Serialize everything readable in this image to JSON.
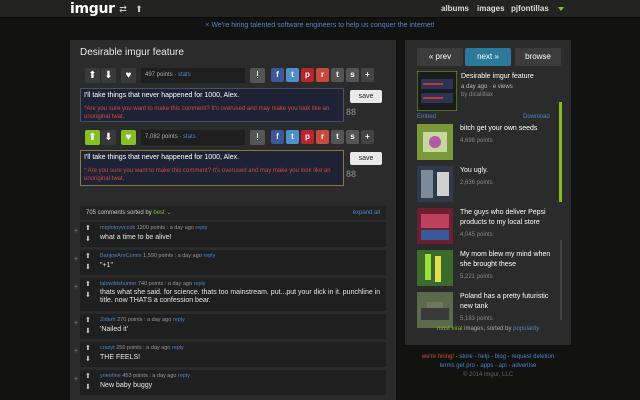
{
  "topbar": {
    "logo": "imgur",
    "nav": [
      "albums",
      "images"
    ],
    "user": "pjfontillas"
  },
  "hire_banner": "× We're hiring talented software engineers to help us conquer the internet!",
  "main": {
    "title": "Desirable imgur feature",
    "rows": [
      {
        "points": "497 points",
        "stats": "stats",
        "comment": "I'll take things that never happened for 1000, Alex.",
        "warning": "*Are you sure you want to make this comment? It's overused and may make you look like an unoriginal twat.",
        "save": "save",
        "counter": "88"
      },
      {
        "points": "7,082 points",
        "stats": "stats",
        "comment": "I'll take things that never happened for 1000, Alex.",
        "warning": "* Are you sure you want to make this comment? It's overused and may make you look like an unoriginal twat.",
        "save": "save",
        "counter": "88"
      }
    ],
    "comments_header": {
      "count_text": "705 comments sorted by",
      "sort": "best",
      "expand": "expand all"
    },
    "comments": [
      {
        "author": "mrplotoyvccok",
        "meta": "1200 points : a day ago",
        "reply": "reply",
        "text": "what a time to be alive!"
      },
      {
        "author": "BanjoeAreComin",
        "meta": "1,590 points : a day ago",
        "reply": "reply",
        "text": "\"+1\""
      },
      {
        "author": "lalowildshunter",
        "meta": "740 points : a day ago",
        "reply": "reply",
        "text": "thats what she said. for science. thats too mainstream. put...put your dick in it. punchline in title. now THATS a confession bear."
      },
      {
        "author": "Zidarh",
        "meta": "270 points : a day ago",
        "reply": "reply",
        "text": "'Nailed it'"
      },
      {
        "author": "crazyt",
        "meta": "250 points : a day ago",
        "reply": "reply",
        "text": "THE FEELS!"
      },
      {
        "author": "yoeofine",
        "meta": "453 points : a day ago",
        "reply": "reply",
        "text": "New baby buggy"
      }
    ]
  },
  "sidebar": {
    "prev": "« prev",
    "next": "next »",
    "browse": "browse",
    "current": {
      "title": "Desirable imgur feature",
      "meta": "a day ago · e views",
      "by": "by dicalilliax",
      "embed": "Embed",
      "download": "Download"
    },
    "items": [
      {
        "title": "bitch get your own seeds",
        "views": "4,698 points"
      },
      {
        "title": "You ugly.",
        "views": "2,636 points"
      },
      {
        "title": "The guys who deliver Pepsi products to my local store",
        "views": "4,045 points"
      },
      {
        "title": "My mom blew my mind when she brought these",
        "views": "5,221 points"
      },
      {
        "title": "Poland has a pretty futuristic new tank",
        "views": "5,183 points"
      }
    ],
    "footer": {
      "pre": "most viral",
      "mid": "images, sorted by",
      "sort": "popularity"
    }
  },
  "footer": {
    "line1": [
      "we're hiring!",
      "store",
      "help",
      "blog",
      "request deletion"
    ],
    "line2": [
      "terms",
      "get pro",
      "apps",
      "api",
      "advertise"
    ],
    "copyright": "© 2014 imgur, LLC"
  }
}
